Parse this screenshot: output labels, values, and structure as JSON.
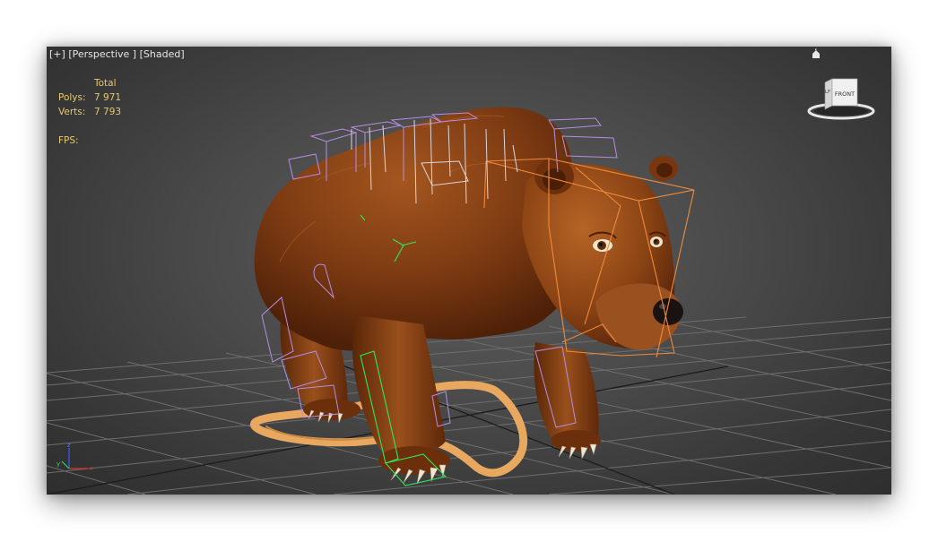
{
  "viewport": {
    "menu_plus": "[+]",
    "menu_view": "[Perspective ]",
    "menu_shading": "[Shaded]"
  },
  "stats": {
    "header": "Total",
    "polys_label": "Polys:",
    "polys_value": "7 971",
    "verts_label": "Verts:",
    "verts_value": "7 793",
    "fps_label": "FPS:"
  },
  "viewcube": {
    "face_front": "FRONT",
    "face_left": "LF"
  },
  "axis_gizmo": {
    "z": "z",
    "y": "y",
    "x": "x"
  },
  "icons": [
    "home-icon",
    "viewcube-icon",
    "axis-gizmo-icon"
  ],
  "colors": {
    "stats_text": "#e6c870",
    "grid": "#6d6d6d",
    "grid_axis": "#1a1a1a",
    "fur": "#8a4316",
    "bone_orange": "#f08a3c",
    "bone_purple": "#b58ee0",
    "bone_green": "#2ee85a",
    "footstep": "#e8a860"
  }
}
